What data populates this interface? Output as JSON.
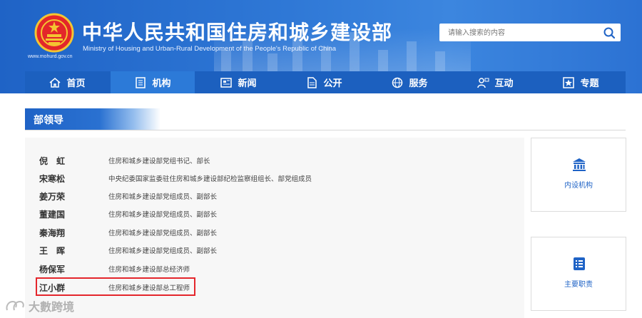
{
  "header": {
    "title_cn": "中华人民共和国住房和城乡建设部",
    "title_en": "Ministry of Housing and Urban-Rural Development of the People's Republic of China",
    "site_url": "www.mohurd.gov.cn",
    "search_placeholder": "请输入搜索的内容"
  },
  "nav": {
    "items": [
      {
        "label": "首页",
        "icon": "home-icon"
      },
      {
        "label": "机构",
        "icon": "building-icon"
      },
      {
        "label": "新闻",
        "icon": "newspaper-icon"
      },
      {
        "label": "公开",
        "icon": "document-icon"
      },
      {
        "label": "服务",
        "icon": "globe-icon"
      },
      {
        "label": "互动",
        "icon": "user-chat-icon"
      },
      {
        "label": "专题",
        "icon": "star-icon"
      }
    ],
    "active": "机构"
  },
  "section": {
    "title": "部领导"
  },
  "leaders": [
    {
      "name": "倪　虹",
      "title": "住房和城乡建设部党组书记、部长"
    },
    {
      "name": "宋寒松",
      "title": "中央纪委国家监委驻住房和城乡建设部纪检监察组组长、部党组成员"
    },
    {
      "name": "姜万荣",
      "title": "住房和城乡建设部党组成员、副部长"
    },
    {
      "name": "董建国",
      "title": "住房和城乡建设部党组成员、副部长"
    },
    {
      "name": "秦海翔",
      "title": "住房和城乡建设部党组成员、副部长"
    },
    {
      "name": "王　晖",
      "title": "住房和城乡建设部党组成员、副部长"
    },
    {
      "name": "杨保军",
      "title": "住房和城乡建设部总经济师"
    },
    {
      "name": "江小群",
      "title": "住房和城乡建设部总工程师"
    }
  ],
  "side_cards": [
    {
      "label": "内设机构",
      "icon": "institution-icon"
    },
    {
      "label": "主要职责",
      "icon": "list-icon"
    }
  ],
  "watermark": "大數跨境",
  "colors": {
    "primary": "#1f63c6",
    "highlight": "#e4262c",
    "nav": "#1c60bf"
  }
}
